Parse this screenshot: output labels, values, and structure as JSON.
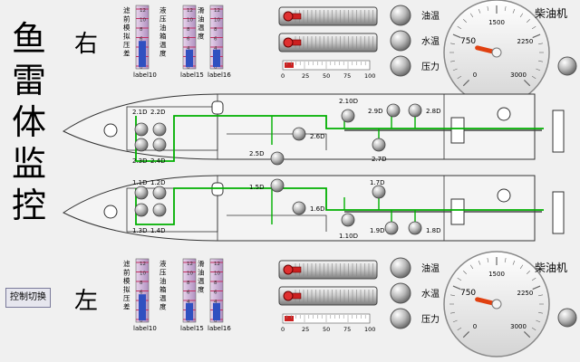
{
  "title_chars": [
    "鱼",
    "雷",
    "体",
    "监",
    "控"
  ],
  "right_label": "右",
  "left_label": "左",
  "switch_button": "控制切换",
  "thermo_labels": [
    "label10",
    "label15",
    "label16"
  ],
  "thermo_scale": [
    "12",
    "10",
    "8",
    "6",
    "4",
    "2",
    "0"
  ],
  "thermo_vertical_text": [
    "滤前模拟压差",
    "液压油箱温度",
    "滑油温度"
  ],
  "indicator_labels": [
    "油温",
    "水温",
    "压力"
  ],
  "gauge_title": "柴油机",
  "gauge_ticks": [
    "0",
    "750",
    "1500",
    "2250",
    "3000"
  ],
  "bar_ticks": [
    "0",
    "25",
    "50",
    "75",
    "100"
  ],
  "gauge_value": 650,
  "hull_top_nodes": [
    "2.1D",
    "2.2D",
    "2.3D",
    "2.4D",
    "2.5D",
    "2.6D",
    "2.10D",
    "2.9D",
    "2.8D",
    "2.7D"
  ],
  "hull_bottom_nodes": [
    "1.1D",
    "1.2D",
    "1.3D",
    "1.4D",
    "1.5D",
    "1.6D",
    "1.10D",
    "1.7D",
    "1.9D",
    "1.8D"
  ],
  "colors": {
    "background": "#f0f0f0",
    "pipe": "#00b000",
    "needle": "#e04010",
    "thermo_fill": "#3050c0"
  }
}
